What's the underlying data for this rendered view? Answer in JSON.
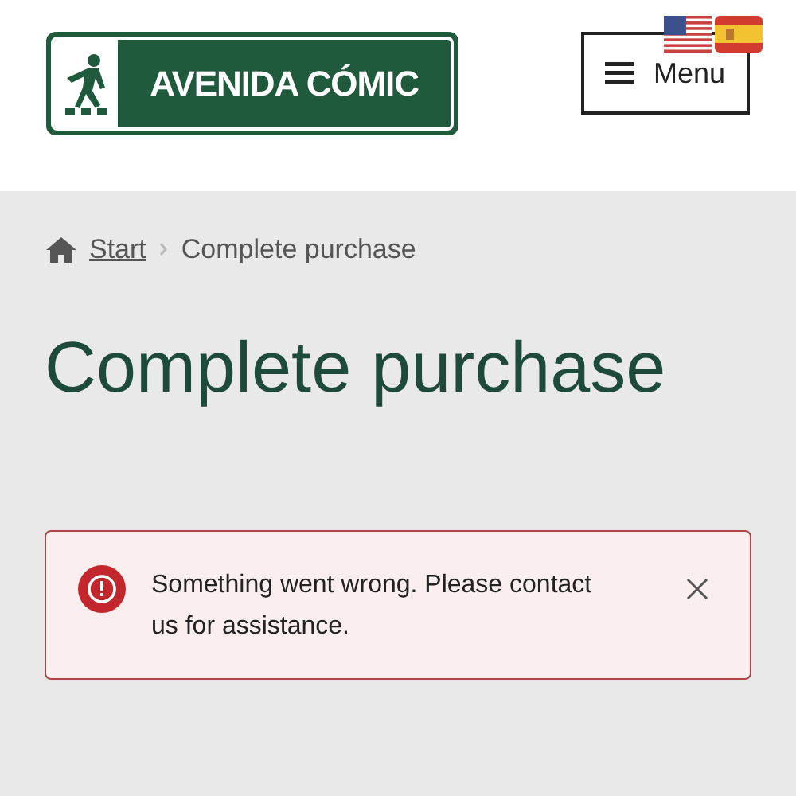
{
  "header": {
    "logo_text": "AVENIDA CÓMIC",
    "menu_button": "Menu"
  },
  "breadcrumb": {
    "items": [
      {
        "label": "Start",
        "kind": "link"
      },
      {
        "label": "Complete purchase",
        "kind": "current"
      }
    ]
  },
  "page_title": "Complete purchase",
  "alert": {
    "message": "Something went wrong. Please contact us for assistance."
  }
}
